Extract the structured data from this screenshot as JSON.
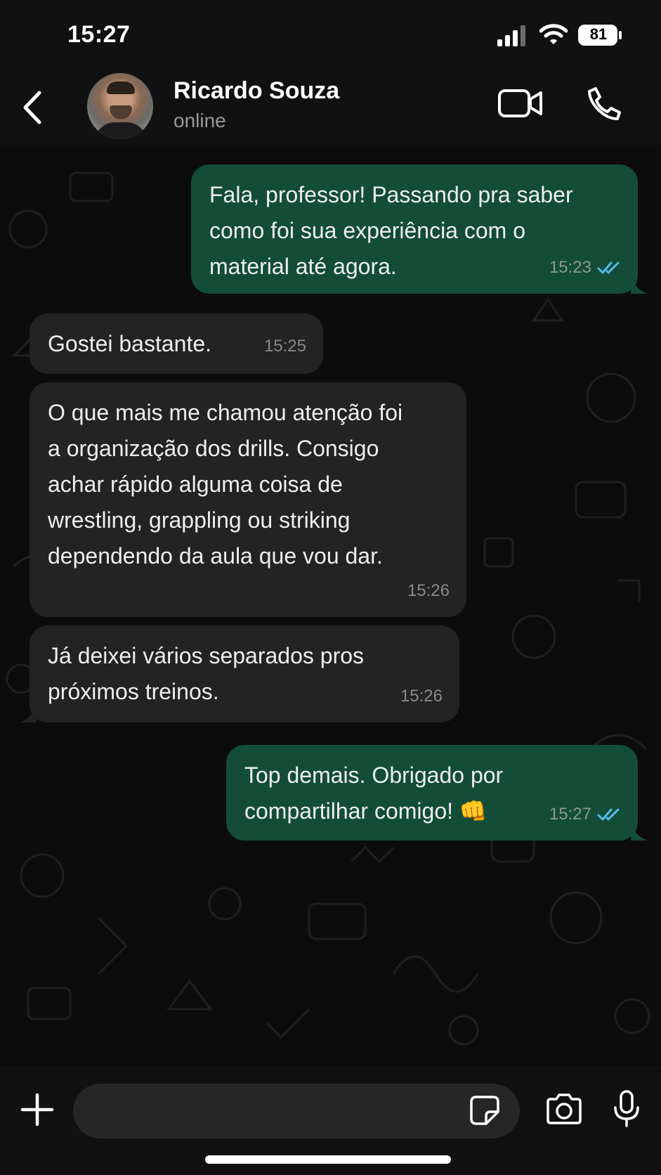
{
  "status_bar": {
    "time": "15:27",
    "battery": "81"
  },
  "header": {
    "contact_name": "Ricardo Souza",
    "contact_status": "online"
  },
  "messages": [
    {
      "direction": "outgoing",
      "text": "Fala, professor! Passando pra saber\ncomo foi sua experiência com o\nmaterial até agora.",
      "time": "15:23",
      "status": "read"
    },
    {
      "direction": "incoming",
      "text": "Gostei bastante.",
      "time": "15:25"
    },
    {
      "direction": "incoming",
      "text": "O que mais me chamou atenção foi\na organização dos drills. Consigo\nachar rápido alguma coisa de\nwrestling, grappling ou striking\ndependendo da aula que vou dar.",
      "time": "15:26"
    },
    {
      "direction": "incoming",
      "text": "Já deixei vários separados pros\npróximos treinos.",
      "time": "15:26"
    },
    {
      "direction": "outgoing",
      "text": "Top demais. Obrigado por\ncompartilhar comigo! 👊",
      "time": "15:27",
      "status": "read"
    }
  ],
  "input": {
    "value": "",
    "placeholder": ""
  },
  "icons": {
    "back": "chevron-left-icon",
    "video": "video-call-icon",
    "call": "phone-icon",
    "attach": "plus-icon",
    "sticker": "sticker-icon",
    "camera": "camera-icon",
    "mic": "microphone-icon",
    "read_receipt": "double-check-icon"
  },
  "colors": {
    "outgoing_bubble": "#134d37",
    "incoming_bubble": "#232323",
    "read_receipt": "#53bdeb",
    "background": "#0b0b0b"
  }
}
